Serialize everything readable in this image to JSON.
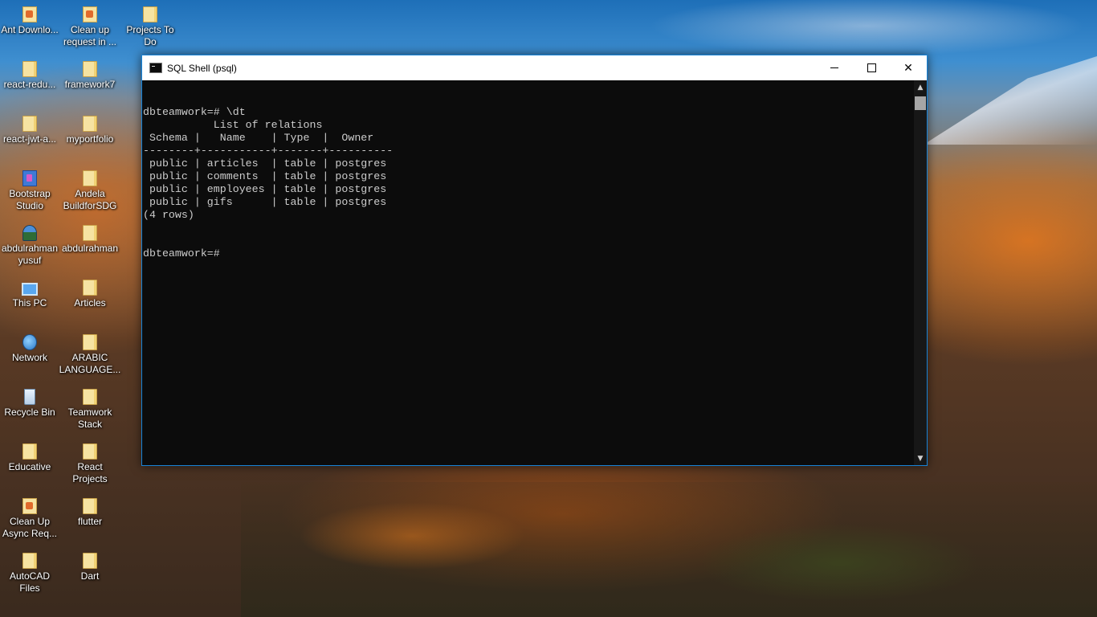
{
  "desktop": {
    "icons": [
      {
        "label": "Ant Downlo...",
        "icon": "app-icon"
      },
      {
        "label": "Clean up request in ...",
        "icon": "app-icon"
      },
      {
        "label": "Projects To Do",
        "icon": "folder-icon"
      },
      {
        "label": "react-redu...",
        "icon": "folder-icon"
      },
      {
        "label": "framework7",
        "icon": "folder-icon"
      },
      {
        "label": "react-jwt-a...",
        "icon": "folder-icon"
      },
      {
        "label": "myportfolio",
        "icon": "folder-icon"
      },
      {
        "label": "Bootstrap Studio",
        "icon": "bootstrap-studio-icon"
      },
      {
        "label": "Andela BuildforSDG",
        "icon": "folder-icon"
      },
      {
        "label": "abdulrahman yusuf",
        "icon": "user-folder-icon"
      },
      {
        "label": "abdulrahman",
        "icon": "folder-icon"
      },
      {
        "label": "This PC",
        "icon": "computer-icon"
      },
      {
        "label": "Articles",
        "icon": "folder-icon"
      },
      {
        "label": "Network",
        "icon": "network-icon"
      },
      {
        "label": "ARABIC LANGUAGE...",
        "icon": "folder-icon"
      },
      {
        "label": "Recycle Bin",
        "icon": "recycle-bin-icon"
      },
      {
        "label": "Teamwork Stack",
        "icon": "folder-icon"
      },
      {
        "label": "Educative",
        "icon": "folder-icon"
      },
      {
        "label": "React Projects",
        "icon": "folder-icon"
      },
      {
        "label": "Clean Up Async Req...",
        "icon": "app-icon"
      },
      {
        "label": "flutter",
        "icon": "folder-icon"
      },
      {
        "label": "AutoCAD Files",
        "icon": "folder-icon"
      },
      {
        "label": "Dart",
        "icon": "folder-icon"
      }
    ]
  },
  "window": {
    "title": "SQL Shell (psql)",
    "controls": {
      "minimize": "minimize-icon",
      "maximize": "maximize-icon",
      "close_glyph": "✕"
    },
    "console_lines": [
      "dbteamwork=# \\dt",
      "           List of relations",
      " Schema |   Name    | Type  |  Owner",
      "--------+-----------+-------+----------",
      " public | articles  | table | postgres",
      " public | comments  | table | postgres",
      " public | employees | table | postgres",
      " public | gifs      | table | postgres",
      "(4 rows)",
      "",
      "",
      "dbteamwork=#"
    ],
    "scrollbar": {
      "up_glyph": "▲",
      "down_glyph": "▼"
    }
  }
}
